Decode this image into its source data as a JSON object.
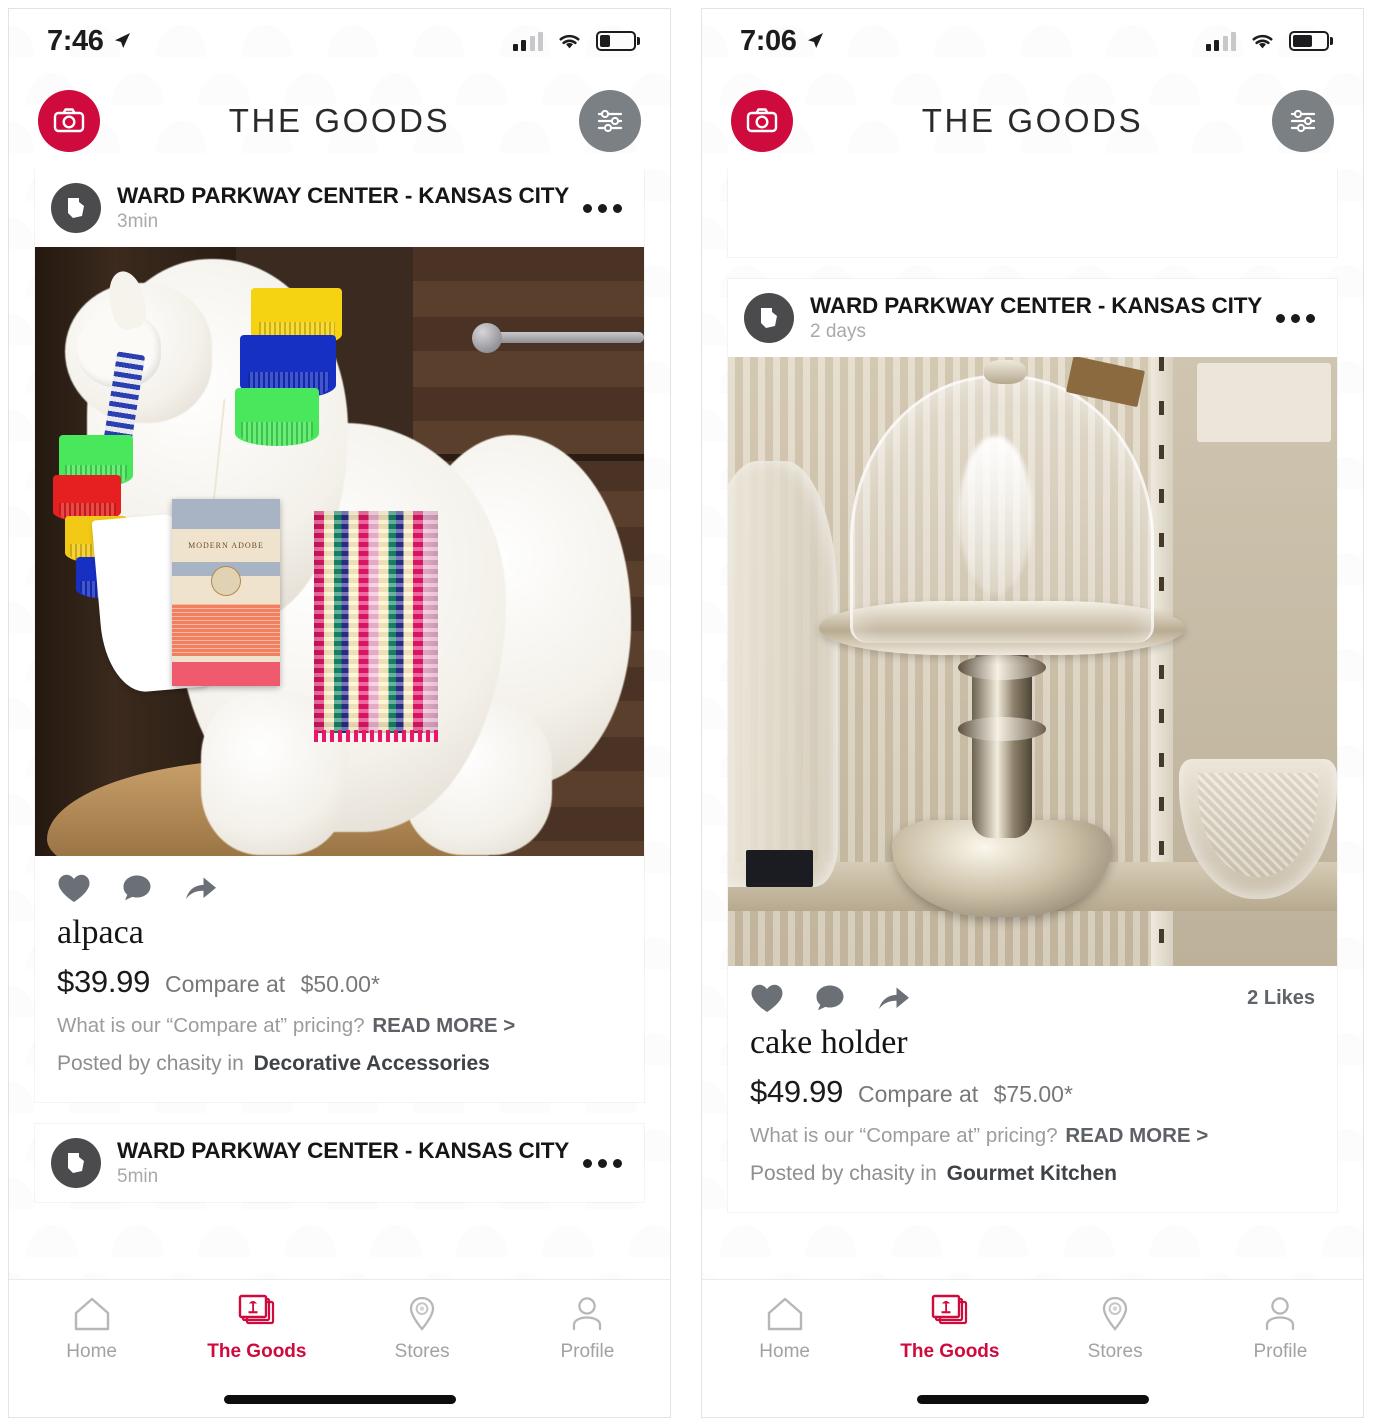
{
  "app": {
    "title": "THE GOODS",
    "accent_color": "#cf0a3c",
    "filter_button_color": "#7b8085",
    "camera_icon": "camera-icon",
    "filter_icon": "sliders-filter-icon"
  },
  "panels": [
    {
      "status": {
        "time": "7:46",
        "location_icon": "location-arrow-icon",
        "signal_bars": 2,
        "wifi": "wifi-icon",
        "battery_percent": 30
      },
      "cards": [
        {
          "kind": "post",
          "store": "WARD PARKWAY CENTER - KANSAS CITY",
          "time": "3min",
          "avatar_icon": "missouri-state-icon",
          "more_icon": "more-dots-icon",
          "photo": "alpaca",
          "likes": "",
          "item": "alpaca",
          "price": "$39.99",
          "compare_label": "Compare at",
          "compare_price": "$50.00*",
          "pricing_question": "What is our “Compare at” pricing?",
          "read_more": "READ MORE >",
          "posted_by": "Posted by chasity in",
          "category": "Decorative Accessories"
        },
        {
          "kind": "header-only",
          "store": "WARD PARKWAY CENTER - KANSAS CITY",
          "time": "5min",
          "avatar_icon": "missouri-state-icon",
          "more_icon": "more-dots-icon"
        }
      ],
      "tabs": [
        {
          "label": "Home",
          "icon": "home-icon",
          "active": false
        },
        {
          "label": "The Goods",
          "icon": "stacked-cards-lamp-icon",
          "active": true
        },
        {
          "label": "Stores",
          "icon": "map-pin-icon",
          "active": false
        },
        {
          "label": "Profile",
          "icon": "person-icon",
          "active": false
        }
      ]
    },
    {
      "status": {
        "time": "7:06",
        "location_icon": "location-arrow-icon",
        "signal_bars": 2,
        "wifi": "wifi-icon",
        "battery_percent": 60
      },
      "cards": [
        {
          "kind": "blank"
        },
        {
          "kind": "post",
          "store": "WARD PARKWAY CENTER - KANSAS CITY",
          "time": "2 days",
          "avatar_icon": "missouri-state-icon",
          "more_icon": "more-dots-icon",
          "photo": "cake",
          "likes": "2 Likes",
          "item": "cake holder",
          "price": "$49.99",
          "compare_label": "Compare at",
          "compare_price": "$75.00*",
          "pricing_question": "What is our “Compare at” pricing?",
          "read_more": "READ MORE >",
          "posted_by": "Posted by chasity in",
          "category": "Gourmet Kitchen"
        }
      ],
      "tabs": [
        {
          "label": "Home",
          "icon": "home-icon",
          "active": false
        },
        {
          "label": "The Goods",
          "icon": "stacked-cards-lamp-icon",
          "active": true
        },
        {
          "label": "Stores",
          "icon": "map-pin-icon",
          "active": false
        },
        {
          "label": "Profile",
          "icon": "person-icon",
          "active": false
        }
      ]
    }
  ]
}
